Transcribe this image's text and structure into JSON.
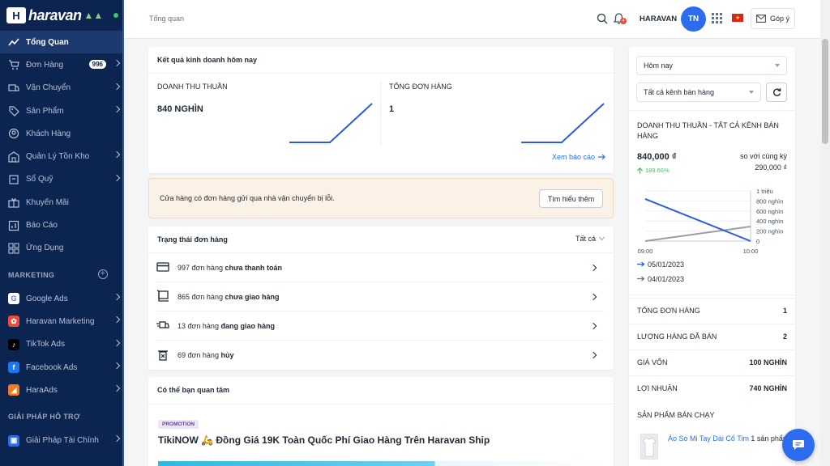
{
  "brand": {
    "name": "haravan",
    "logo_letter": "H"
  },
  "sidebar": {
    "items": [
      {
        "label": "Tổng Quan",
        "icon": "trend-icon"
      },
      {
        "label": "Đơn Hàng",
        "icon": "cart-icon",
        "badge": "996"
      },
      {
        "label": "Vận Chuyển",
        "icon": "truck-icon"
      },
      {
        "label": "Sản Phẩm",
        "icon": "tag-icon"
      },
      {
        "label": "Khách Hàng",
        "icon": "user-icon"
      },
      {
        "label": "Quản Lý Tồn Kho",
        "icon": "warehouse-icon"
      },
      {
        "label": "Sổ Quỹ",
        "icon": "cashbook-icon"
      },
      {
        "label": "Khuyến Mãi",
        "icon": "gift-icon"
      },
      {
        "label": "Báo Cáo",
        "icon": "report-icon"
      },
      {
        "label": "Ứng Dụng",
        "icon": "apps-icon"
      }
    ],
    "marketing_title": "MARKETING",
    "marketing": [
      {
        "label": "Google Ads",
        "icon": "google-icon",
        "color": "#ffffff",
        "letter": "G"
      },
      {
        "label": "Haravan Marketing",
        "icon": "haravan-marketing-icon",
        "color": "#e94c3d",
        "letter": "✿"
      },
      {
        "label": "TikTok Ads",
        "icon": "tiktok-icon",
        "color": "#000000",
        "letter": "♪"
      },
      {
        "label": "Facebook Ads",
        "icon": "facebook-icon",
        "color": "#1877f2",
        "letter": "f"
      },
      {
        "label": "HaraAds",
        "icon": "haraads-icon",
        "color": "#f47a20",
        "letter": "◢"
      }
    ],
    "support_title": "GIẢI PHÁP HỖ TRỢ",
    "support": [
      {
        "label": "Giải Pháp Tài Chính",
        "icon": "finance-icon",
        "color": "#2d6cf0",
        "letter": "▣"
      }
    ]
  },
  "topbar": {
    "breadcrumb": "Tổng quan",
    "notif_count": "4",
    "store_name": "HARAVAN",
    "avatar_initials": "TN",
    "feedback_label": "Góp ý"
  },
  "business": {
    "title": "Kết quả kinh doanh hôm nay",
    "revenue_label": "DOANH THU THUẦN",
    "revenue_value": "840 NGHÌN",
    "orders_label": "TỔNG ĐƠN HÀNG",
    "orders_value": "1",
    "report_link": "Xem báo cáo"
  },
  "alert": {
    "text": "Cửa hàng có đơn hàng gửi qua nhà vận chuyển bị lỗi.",
    "button": "Tìm hiểu thêm"
  },
  "order_status": {
    "title": "Trạng thái đơn hàng",
    "filter": "Tất cả",
    "rows": [
      {
        "prefix": "997 đơn hàng ",
        "status": "chưa thanh toán",
        "icon": "card-icon"
      },
      {
        "prefix": "865 đơn hàng ",
        "status": "chưa giao hàng",
        "icon": "package-icon"
      },
      {
        "prefix": "13 đơn hàng ",
        "status": "đang giao hàng",
        "icon": "delivery-icon"
      },
      {
        "prefix": "69 đơn hàng ",
        "status": "hủy",
        "icon": "trash-icon"
      }
    ]
  },
  "interest": {
    "title": "Có thể bạn quan tâm",
    "tag": "PROMOTION",
    "headline": "TikiNOW 🛵 Đồng Giá 19K Toàn Quốc Phí Giao Hàng Trên Haravan Ship"
  },
  "right_panel": {
    "date_select": "Hôm nay",
    "channel_select": "Tất cả kênh bán hàng",
    "chart_title": "DOANH THU THUẦN - TẤT CẢ KÊNH BÁN HÀNG",
    "value": "840,000 ₫",
    "growth": "189.66%",
    "compare_label": "so với cùng kỳ",
    "compare_value": "290,000 ₫",
    "stats": [
      {
        "label": "TỔNG ĐƠN HÀNG",
        "value": "1"
      },
      {
        "label": "LƯỢNG HÀNG ĐÃ BÁN",
        "value": "2"
      },
      {
        "label": "GIÁ VỐN",
        "value": "100 NGHÌN"
      },
      {
        "label": "LỢI NHUẬN",
        "value": "740 NGHÌN"
      }
    ],
    "bestseller_title": "SẢN PHẨM BÁN CHẠY",
    "bestseller_item": "Áo So Mi Tay Dài Cổ Tim",
    "bestseller_qty": "1 sản phẩm"
  },
  "chart_data": {
    "type": "line",
    "x": [
      "09:00",
      "10:00"
    ],
    "ylim": [
      0,
      1000000
    ],
    "yticks": [
      "0",
      "200 nghìn",
      "400 nghìn",
      "600 nghìn",
      "800 nghìn",
      "1 triệu"
    ],
    "series": [
      {
        "name": "05/01/2023",
        "values": [
          840000,
          0
        ],
        "color": "#2d5be3"
      },
      {
        "name": "04/01/2023",
        "values": [
          0,
          290000
        ],
        "color": "#9e9e9e"
      }
    ]
  },
  "colors": {
    "sidebar": "#0b2450",
    "accent": "#2d6cf0",
    "alert_bg": "#fcf1e6",
    "growth": "#3bc46b"
  }
}
